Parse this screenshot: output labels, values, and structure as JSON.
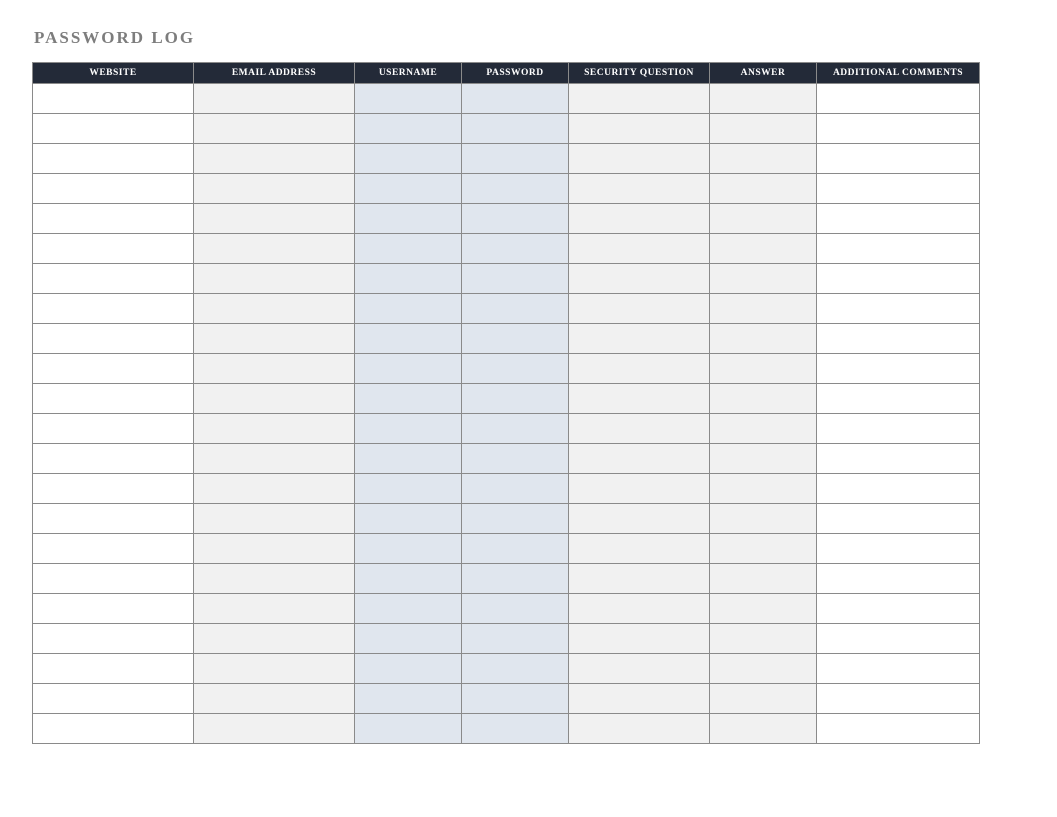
{
  "title": "PASSWORD LOG",
  "headers": [
    "WEBSITE",
    "EMAIL ADDRESS",
    "USERNAME",
    "PASSWORD",
    "SECURITY QUESTION",
    "ANSWER",
    "ADDITIONAL COMMENTS"
  ],
  "rowCount": 22,
  "columnColors": [
    "white",
    "gray",
    "blue",
    "blue",
    "gray",
    "gray",
    "white"
  ],
  "colors": {
    "headerBg": "#232a38",
    "headerText": "#ffffff",
    "titleText": "#7d7d7d",
    "cellWhite": "#ffffff",
    "cellGray": "#f1f1f1",
    "cellBlue": "#e0e6ee",
    "border": "#8a8a8a"
  }
}
